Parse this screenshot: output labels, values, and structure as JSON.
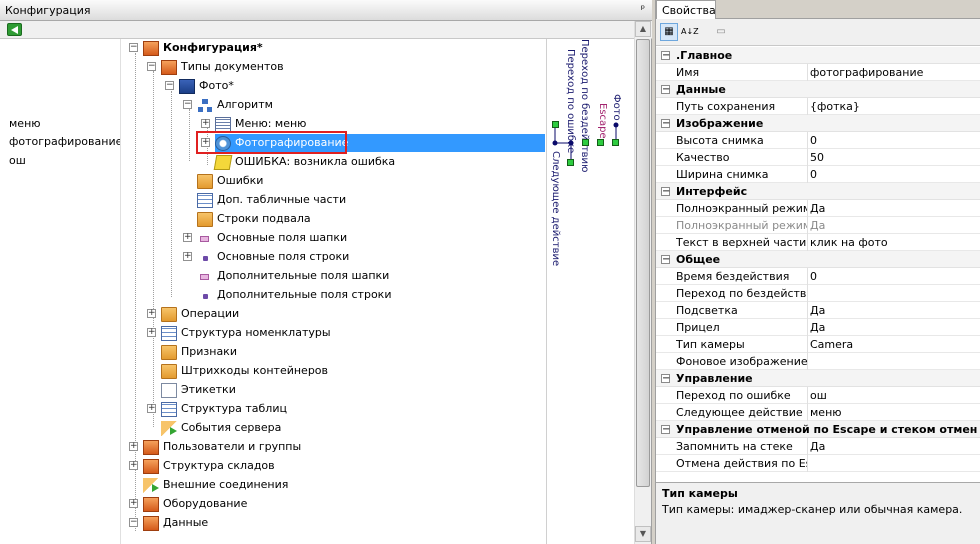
{
  "left_panel": {
    "title": "Конфигурация",
    "pin": "ᵖ",
    "left_list": [
      "меню",
      "фотографирование",
      "ош"
    ]
  },
  "tree": {
    "rows": [
      {
        "label": "Конфигурация*",
        "bold": true
      },
      {
        "label": "Типы документов"
      },
      {
        "label": "Фото*"
      },
      {
        "label": "Алгоритм"
      },
      {
        "label": "Меню: меню"
      },
      {
        "label": "Фотографирование"
      },
      {
        "label": "ОШИБКА: возникла ошибка"
      },
      {
        "label": "Ошибки"
      },
      {
        "label": "Доп. табличные части"
      },
      {
        "label": "Строки подвала"
      },
      {
        "label": "Основные поля шапки"
      },
      {
        "label": "Основные поля строки"
      },
      {
        "label": "Дополнительные поля шапки"
      },
      {
        "label": "Дополнительные поля строки"
      },
      {
        "label": "Операции"
      },
      {
        "label": "Структура номенклатуры"
      },
      {
        "label": "Признаки"
      },
      {
        "label": "Штрихкоды контейнеров"
      },
      {
        "label": "Этикетки"
      },
      {
        "label": "Структура таблиц"
      },
      {
        "label": "События сервера"
      },
      {
        "label": "Пользователи и группы"
      },
      {
        "label": "Структура складов"
      },
      {
        "label": "Внешние соединения"
      },
      {
        "label": "Оборудование"
      },
      {
        "label": "Данные"
      }
    ]
  },
  "graph": {
    "labels": [
      "Переход по ошибке",
      "Переход по бездействию",
      "Escape",
      "Фото",
      "Следующее действие"
    ]
  },
  "right_panel": {
    "tab": "Свойства",
    "toolbar": {
      "categorized": "▦",
      "sort": "A↓Z",
      "pages": "▭"
    },
    "sections": [
      {
        "title": ".Главное",
        "rows": [
          {
            "k": "Имя",
            "v": "фотографирование"
          }
        ]
      },
      {
        "title": "Данные",
        "rows": [
          {
            "k": "Путь сохранения",
            "v": "{фотка}"
          }
        ]
      },
      {
        "title": "Изображение",
        "rows": [
          {
            "k": "Высота снимка",
            "v": "0"
          },
          {
            "k": "Качество",
            "v": "50"
          },
          {
            "k": "Ширина снимка",
            "v": "0"
          }
        ]
      },
      {
        "title": "Интерфейс",
        "rows": [
          {
            "k": "Полноэкранный режим",
            "v": "Да"
          },
          {
            "k": "Полноэкранный режим (з",
            "v": "Да",
            "grey": true
          },
          {
            "k": "Текст в верхней части ок",
            "v": "клик на фото"
          }
        ]
      },
      {
        "title": "Общее",
        "rows": [
          {
            "k": "Время бездействия",
            "v": "0"
          },
          {
            "k": "Переход по бездействию",
            "v": ""
          },
          {
            "k": "Подсветка",
            "v": "Да"
          },
          {
            "k": "Прицел",
            "v": "Да"
          },
          {
            "k": "Тип камеры",
            "v": "Camera"
          },
          {
            "k": "Фоновое изображение",
            "v": ""
          }
        ]
      },
      {
        "title": "Управление",
        "rows": [
          {
            "k": "Переход по ошибке",
            "v": "ош"
          },
          {
            "k": "Следующее действие",
            "v": "меню"
          }
        ]
      },
      {
        "title": "Управление отменой по Escape и стеком отмен",
        "rows": [
          {
            "k": "Запомнить на стеке",
            "v": "Да"
          },
          {
            "k": "Отмена действия по Esca",
            "v": ""
          }
        ]
      }
    ],
    "description": {
      "title": "Тип камеры",
      "text": "Тип камеры: имаджер-сканер или обычная камера."
    }
  },
  "colors": {
    "selection": "#3399ff",
    "highlight_box": "#e02020",
    "graph_node": "#2ecc40"
  }
}
